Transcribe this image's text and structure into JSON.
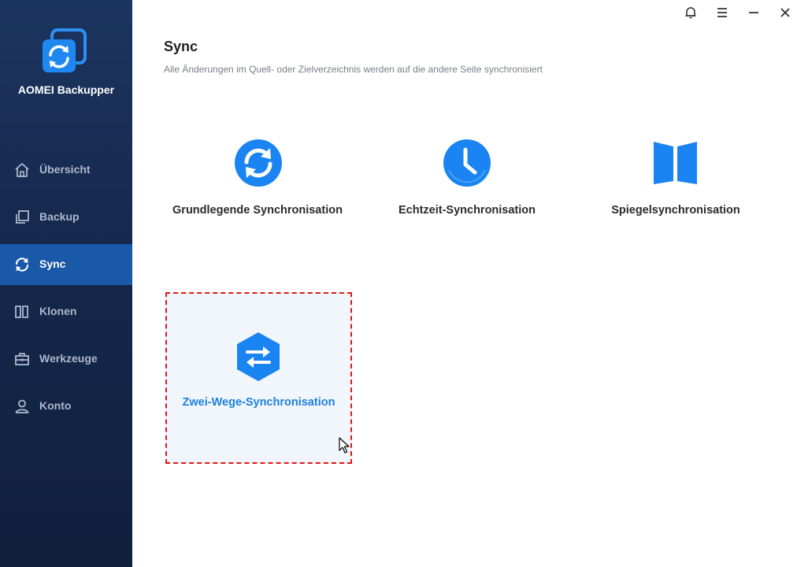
{
  "app": {
    "name": "AOMEI Backupper"
  },
  "sidebar": {
    "items": [
      {
        "label": "Übersicht",
        "icon": "home-icon",
        "active": false
      },
      {
        "label": "Backup",
        "icon": "copy-icon",
        "active": false
      },
      {
        "label": "Sync",
        "icon": "sync-icon",
        "active": true
      },
      {
        "label": "Klonen",
        "icon": "clone-icon",
        "active": false
      },
      {
        "label": "Werkzeuge",
        "icon": "toolbox-icon",
        "active": false
      },
      {
        "label": "Konto",
        "icon": "user-icon",
        "active": false
      }
    ]
  },
  "topbar": {
    "icons": [
      "bell-icon",
      "menu-icon",
      "minimize-icon",
      "close-icon"
    ]
  },
  "main": {
    "title": "Sync",
    "subtitle": "Alle Änderungen im Quell- oder Zielverzeichnis werden auf die andere Seite synchronisiert",
    "options": [
      {
        "label": "Grundlegende Synchronisation",
        "icon": "basic-sync-icon"
      },
      {
        "label": "Echtzeit-Synchronisation",
        "icon": "clock-icon"
      },
      {
        "label": "Spiegelsynchronisation",
        "icon": "mirror-icon"
      },
      {
        "label": "Zwei-Wege-Synchronisation",
        "icon": "two-way-sync-icon",
        "selected": true
      }
    ]
  },
  "colors": {
    "accent": "#1b7fe0",
    "icon_blue": "#1a84f2",
    "sidebar_bg": "#15284c",
    "sidebar_active": "#1a58a8",
    "selection_border": "#e01818"
  }
}
